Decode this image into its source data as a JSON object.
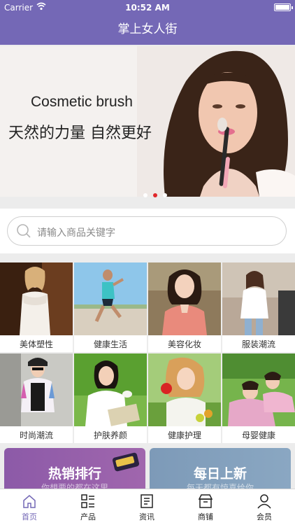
{
  "status_bar": {
    "carrier": "Carrier",
    "time": "10:52 AM",
    "battery_level": 0.9
  },
  "nav": {
    "title": "掌上女人街"
  },
  "banner": {
    "english_text": "Cosmetic brush",
    "chinese_text": "天然的力量 自然更好",
    "slide_count": 3,
    "active_slide": 2
  },
  "search": {
    "placeholder": "请输入商品关键字"
  },
  "categories": [
    {
      "label": "美体塑性"
    },
    {
      "label": "健康生活"
    },
    {
      "label": "美容化妆"
    },
    {
      "label": "服装潮流"
    },
    {
      "label": "时尚潮流"
    },
    {
      "label": "护肤养颜"
    },
    {
      "label": "健康护理"
    },
    {
      "label": "母婴健康"
    }
  ],
  "promos": [
    {
      "title": "热销排行",
      "subtitle": "你想要的都在这里"
    },
    {
      "title": "每日上新",
      "subtitle": "每天都有惊喜给你"
    }
  ],
  "tabs": [
    {
      "label": "首页",
      "icon": "home-icon"
    },
    {
      "label": "产品",
      "icon": "product-list-icon"
    },
    {
      "label": "资讯",
      "icon": "news-icon"
    },
    {
      "label": "商铺",
      "icon": "shop-icon"
    },
    {
      "label": "会员",
      "icon": "member-icon"
    }
  ],
  "colors": {
    "accent": "#7468b6",
    "active_dot": "#e0272b",
    "promo_left": "#8c5aa8",
    "promo_right": "#7d9ab8"
  }
}
